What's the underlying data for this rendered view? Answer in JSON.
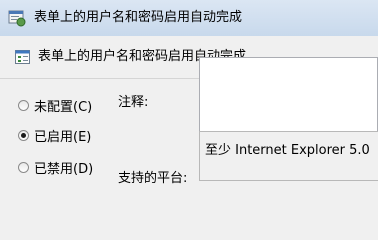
{
  "window": {
    "title": "表单上的用户名和密码启用自动完成",
    "icon": "policy-settings-icon"
  },
  "policy": {
    "title": "表单上的用户名和密码启用自动完成",
    "icon": "policy-icon"
  },
  "options": {
    "not_configured": "未配置(C)",
    "enabled": "已启用(E)",
    "disabled": "已禁用(D)",
    "selected": "enabled"
  },
  "comment": {
    "label": "注释:",
    "value": ""
  },
  "supported": {
    "label": "支持的平台:",
    "value": "至少 Internet Explorer 5.0"
  }
}
